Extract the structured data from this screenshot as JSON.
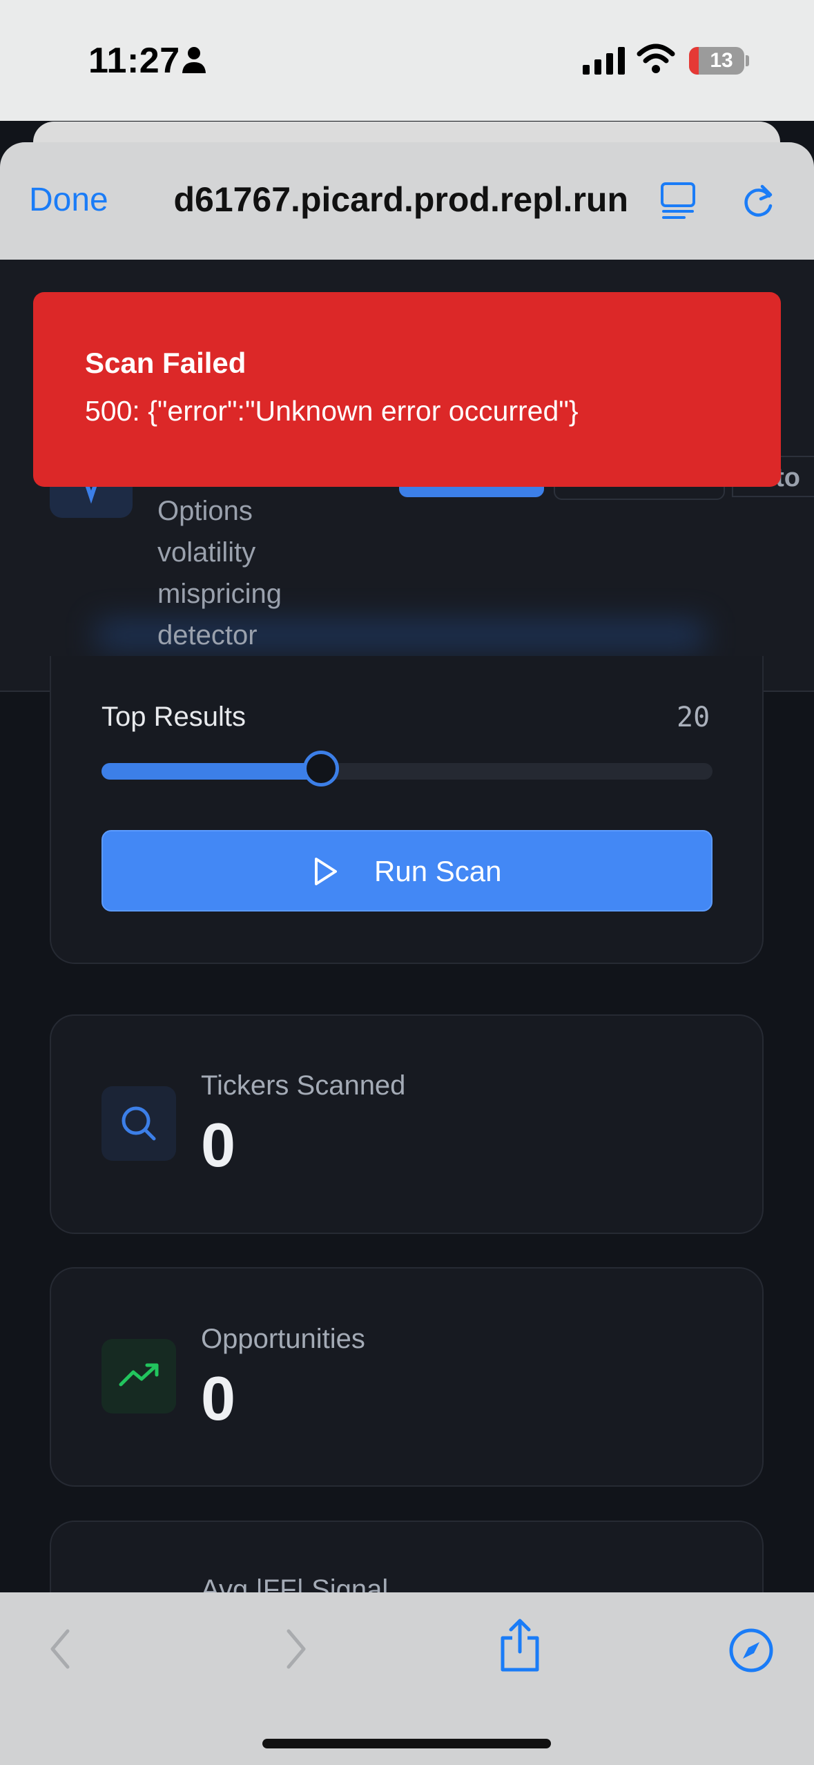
{
  "status_bar": {
    "time": "11:27",
    "battery": "13",
    "icons": [
      "person-icon",
      "signal-icon",
      "wifi-icon",
      "battery-icon"
    ]
  },
  "browser": {
    "done_label": "Done",
    "url": "d61767.picard.prod.repl.run",
    "icons": [
      "reader-icon",
      "reload-icon"
    ],
    "accent": "#1a7cf7"
  },
  "header": {
    "tagline": "Options volatility mispricing detector",
    "tab_partial": "sto"
  },
  "toast": {
    "title": "Scan Failed",
    "message": "500: {\"error\":\"Unknown error occurred\"}",
    "color": "#dc2828"
  },
  "controls": {
    "top_results_label": "Top Results",
    "top_results_value": "20",
    "slider_fraction": 0.33,
    "run_label": "Run Scan"
  },
  "stats": [
    {
      "label": "Tickers Scanned",
      "value": "0",
      "icon": "search-icon"
    },
    {
      "label": "Opportunities",
      "value": "0",
      "icon": "trending-up-icon"
    },
    {
      "label": "Avg |FF| Signal",
      "value": "",
      "icon": ""
    }
  ],
  "toolbar": {
    "icons": [
      "back-icon",
      "forward-icon",
      "share-icon",
      "compass-icon"
    ]
  }
}
